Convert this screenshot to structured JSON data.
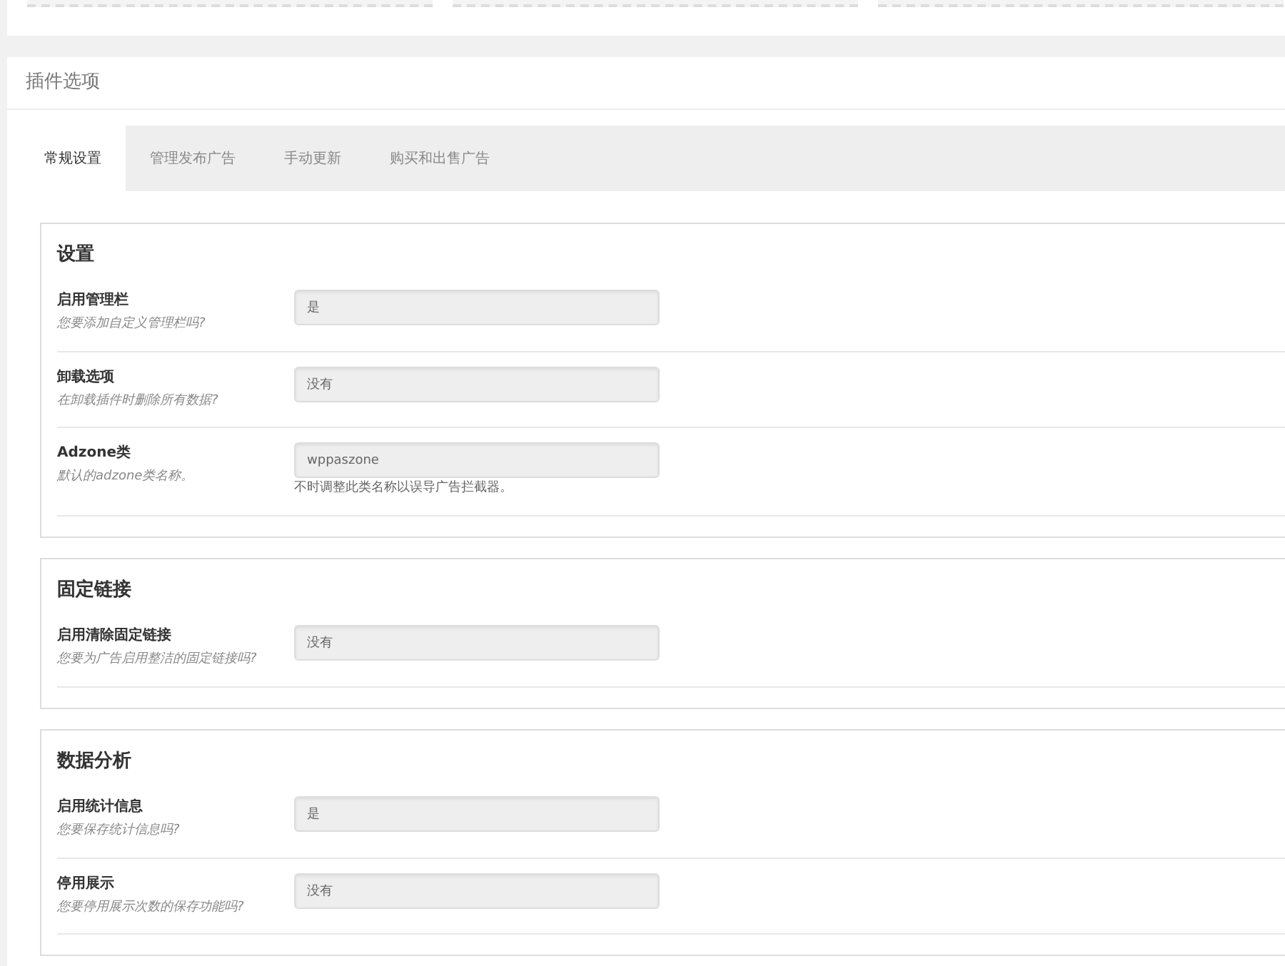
{
  "panel_title": "插件选项",
  "tabs": [
    {
      "label": "常规设置",
      "selected": true
    },
    {
      "label": "管理发布广告",
      "selected": false
    },
    {
      "label": "手动更新",
      "selected": false
    },
    {
      "label": "购买和出售广告",
      "selected": false
    }
  ],
  "sections": [
    {
      "title": "设置",
      "rows": [
        {
          "label": "启用管理栏",
          "description": "您要添加自定义管理栏吗?",
          "value": "是"
        },
        {
          "label": "卸载选项",
          "description": "在卸载插件时删除所有数据?",
          "value": "没有"
        },
        {
          "label": "Adzone类",
          "description": "默认的adzone类名称。",
          "value": "wppaszone",
          "hint": "不时调整此类名称以误导广告拦截器。"
        }
      ]
    },
    {
      "title": "固定链接",
      "rows": [
        {
          "label": "启用清除固定链接",
          "description": "您要为广告启用整洁的固定链接吗?",
          "value": "没有"
        }
      ]
    },
    {
      "title": "数据分析",
      "rows": [
        {
          "label": "启用统计信息",
          "description": "您要保存统计信息吗?",
          "value": "是"
        },
        {
          "label": "停用展示",
          "description": "您要停用展示次数的保存功能吗?",
          "value": "没有"
        }
      ]
    }
  ]
}
